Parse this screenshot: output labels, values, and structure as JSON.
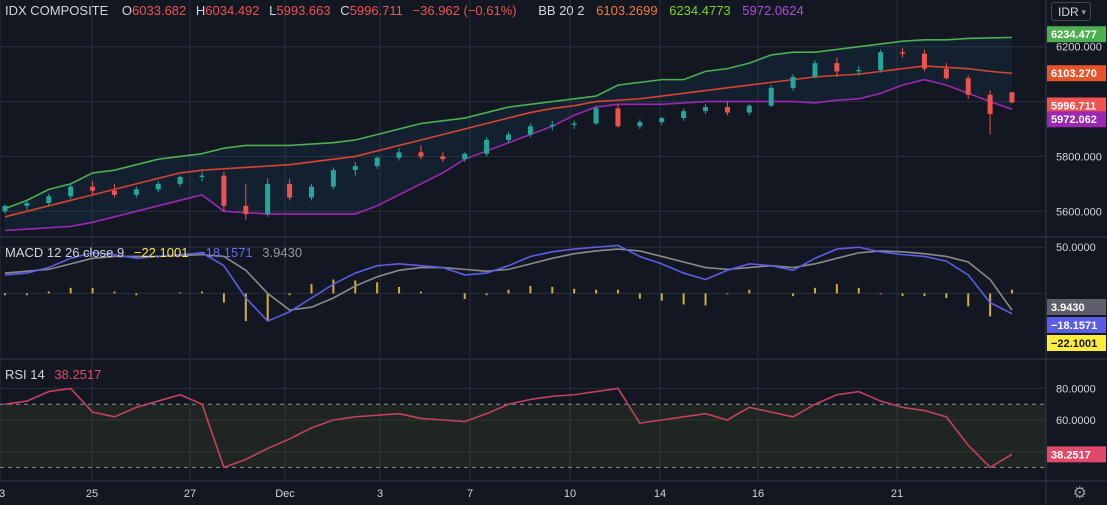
{
  "symbol": "IDX COMPOSITE",
  "ohlc": {
    "o_label": "O",
    "o": "6033.682",
    "h_label": "H",
    "h": "6034.492",
    "l_label": "L",
    "l": "5993.663",
    "c_label": "C",
    "c": "5996.711",
    "change": "−36.962 (−0.61%)"
  },
  "bb": {
    "label": "BB 20 2",
    "basis": "6103.2699",
    "upper": "6234.4773",
    "lower": "5972.0624"
  },
  "macd": {
    "label": "MACD 12 26 close 9",
    "macd": "−22.1001",
    "signal": "−18.1571",
    "hist": "3.9430"
  },
  "rsi": {
    "label": "RSI 14",
    "value": "38.2517"
  },
  "currency": "IDR",
  "colors": {
    "up": "#26a69a",
    "down": "#ef5350",
    "bb_upper": "#4caf50",
    "bb_basis": "#d5452f",
    "bb_lower": "#9c27b0",
    "macd": "#5b5ee5",
    "signal": "#8a8a8a",
    "hist": "#d4b03a",
    "rsi": "#c2425e"
  },
  "chart_data": [
    {
      "type": "candlestick",
      "title": "IDX COMPOSITE",
      "ylim": [
        5510,
        6290
      ],
      "y_ticks": [
        "6200.000",
        "5800.000",
        "5600.000"
      ],
      "x_ticks": [
        "3",
        "25",
        "27",
        "Dec",
        "3",
        "7",
        "10",
        "14",
        "16",
        "21"
      ],
      "price_labels": {
        "upper": "6234.477",
        "basis": "6103.270",
        "close": "5996.711",
        "lower": "5972.062"
      },
      "series": [
        {
          "name": "BB upper",
          "values": [
            5610,
            5640,
            5680,
            5700,
            5740,
            5750,
            5770,
            5790,
            5800,
            5810,
            5830,
            5840,
            5840,
            5840,
            5845,
            5850,
            5860,
            5880,
            5900,
            5920,
            5930,
            5940,
            5960,
            5980,
            5990,
            6000,
            6010,
            6020,
            6060,
            6070,
            6080,
            6080,
            6110,
            6120,
            6140,
            6170,
            6180,
            6180,
            6190,
            6200,
            6210,
            6220,
            6225,
            6225,
            6230,
            6232,
            6234
          ]
        },
        {
          "name": "BB basis",
          "values": [
            5580,
            5600,
            5620,
            5640,
            5660,
            5680,
            5700,
            5720,
            5740,
            5750,
            5755,
            5760,
            5765,
            5770,
            5780,
            5790,
            5800,
            5820,
            5840,
            5860,
            5880,
            5900,
            5920,
            5940,
            5960,
            5975,
            5985,
            6000,
            6005,
            6010,
            6020,
            6030,
            6040,
            6050,
            6060,
            6070,
            6080,
            6090,
            6095,
            6100,
            6110,
            6120,
            6130,
            6125,
            6120,
            6110,
            6103
          ]
        },
        {
          "name": "BB lower",
          "values": [
            5530,
            5535,
            5540,
            5545,
            5560,
            5580,
            5600,
            5620,
            5640,
            5660,
            5600,
            5595,
            5590,
            5590,
            5590,
            5590,
            5590,
            5620,
            5660,
            5700,
            5740,
            5790,
            5820,
            5850,
            5880,
            5910,
            5950,
            5980,
            5990,
            5990,
            5990,
            5995,
            6000,
            6000,
            6000,
            6000,
            6000,
            5995,
            6005,
            6010,
            6030,
            6060,
            6080,
            6060,
            6030,
            6000,
            5972
          ]
        }
      ],
      "candles": [
        {
          "o": 5600,
          "h": 5625,
          "l": 5590,
          "c": 5620
        },
        {
          "o": 5620,
          "h": 5640,
          "l": 5605,
          "c": 5630
        },
        {
          "o": 5630,
          "h": 5665,
          "l": 5620,
          "c": 5655
        },
        {
          "o": 5655,
          "h": 5700,
          "l": 5645,
          "c": 5690
        },
        {
          "o": 5690,
          "h": 5710,
          "l": 5660,
          "c": 5675
        },
        {
          "o": 5675,
          "h": 5700,
          "l": 5650,
          "c": 5660
        },
        {
          "o": 5660,
          "h": 5690,
          "l": 5650,
          "c": 5680
        },
        {
          "o": 5680,
          "h": 5710,
          "l": 5670,
          "c": 5700
        },
        {
          "o": 5700,
          "h": 5730,
          "l": 5690,
          "c": 5725
        },
        {
          "o": 5725,
          "h": 5745,
          "l": 5710,
          "c": 5730
        },
        {
          "o": 5730,
          "h": 5745,
          "l": 5600,
          "c": 5620
        },
        {
          "o": 5620,
          "h": 5700,
          "l": 5570,
          "c": 5590
        },
        {
          "o": 5590,
          "h": 5720,
          "l": 5580,
          "c": 5700
        },
        {
          "o": 5700,
          "h": 5720,
          "l": 5640,
          "c": 5650
        },
        {
          "o": 5650,
          "h": 5700,
          "l": 5640,
          "c": 5690
        },
        {
          "o": 5690,
          "h": 5760,
          "l": 5680,
          "c": 5750
        },
        {
          "o": 5750,
          "h": 5780,
          "l": 5730,
          "c": 5765
        },
        {
          "o": 5765,
          "h": 5800,
          "l": 5755,
          "c": 5795
        },
        {
          "o": 5795,
          "h": 5830,
          "l": 5785,
          "c": 5815
        },
        {
          "o": 5815,
          "h": 5840,
          "l": 5790,
          "c": 5800
        },
        {
          "o": 5800,
          "h": 5815,
          "l": 5780,
          "c": 5790
        },
        {
          "o": 5790,
          "h": 5815,
          "l": 5780,
          "c": 5810
        },
        {
          "o": 5810,
          "h": 5870,
          "l": 5800,
          "c": 5860
        },
        {
          "o": 5860,
          "h": 5890,
          "l": 5850,
          "c": 5880
        },
        {
          "o": 5880,
          "h": 5920,
          "l": 5870,
          "c": 5910
        },
        {
          "o": 5910,
          "h": 5930,
          "l": 5895,
          "c": 5915
        },
        {
          "o": 5915,
          "h": 5930,
          "l": 5900,
          "c": 5920
        },
        {
          "o": 5920,
          "h": 5985,
          "l": 5915,
          "c": 5975
        },
        {
          "o": 5975,
          "h": 5990,
          "l": 5905,
          "c": 5910
        },
        {
          "o": 5910,
          "h": 5935,
          "l": 5900,
          "c": 5925
        },
        {
          "o": 5925,
          "h": 5945,
          "l": 5915,
          "c": 5940
        },
        {
          "o": 5940,
          "h": 5975,
          "l": 5930,
          "c": 5965
        },
        {
          "o": 5965,
          "h": 5990,
          "l": 5955,
          "c": 5980
        },
        {
          "o": 5980,
          "h": 6000,
          "l": 5950,
          "c": 5960
        },
        {
          "o": 5960,
          "h": 5990,
          "l": 5950,
          "c": 5985
        },
        {
          "o": 5985,
          "h": 6060,
          "l": 5980,
          "c": 6050
        },
        {
          "o": 6050,
          "h": 6100,
          "l": 6040,
          "c": 6090
        },
        {
          "o": 6090,
          "h": 6150,
          "l": 6085,
          "c": 6140
        },
        {
          "o": 6140,
          "h": 6160,
          "l": 6090,
          "c": 6110
        },
        {
          "o": 6110,
          "h": 6130,
          "l": 6095,
          "c": 6115
        },
        {
          "o": 6115,
          "h": 6190,
          "l": 6105,
          "c": 6180
        },
        {
          "o": 6180,
          "h": 6195,
          "l": 6160,
          "c": 6175
        },
        {
          "o": 6175,
          "h": 6190,
          "l": 6110,
          "c": 6120
        },
        {
          "o": 6120,
          "h": 6140,
          "l": 6080,
          "c": 6085
        },
        {
          "o": 6085,
          "h": 6095,
          "l": 6010,
          "c": 6025
        },
        {
          "o": 6025,
          "h": 6040,
          "l": 5880,
          "c": 5955
        },
        {
          "o": 6033.682,
          "h": 6034.492,
          "l": 5993.663,
          "c": 5996.711
        }
      ]
    },
    {
      "type": "line",
      "title": "MACD 12 26 close 9",
      "ylim": [
        -70,
        60
      ],
      "y_ticks": [
        "50.0000"
      ],
      "price_labels": [
        "3.9430",
        "−18.1571",
        "−22.1001"
      ],
      "series": [
        {
          "name": "MACD",
          "values": [
            20,
            22,
            28,
            38,
            44,
            42,
            38,
            40,
            42,
            44,
            30,
            -5,
            -30,
            -20,
            -5,
            10,
            22,
            30,
            32,
            30,
            28,
            20,
            22,
            30,
            40,
            45,
            48,
            50,
            52,
            40,
            32,
            22,
            15,
            25,
            32,
            30,
            25,
            38,
            48,
            50,
            45,
            42,
            40,
            35,
            20,
            -10,
            -22.1001
          ]
        },
        {
          "name": "Signal",
          "values": [
            22,
            24,
            26,
            32,
            38,
            40,
            40,
            40,
            41,
            42,
            40,
            25,
            0,
            -18,
            -15,
            -5,
            8,
            18,
            25,
            28,
            28,
            26,
            24,
            26,
            32,
            38,
            43,
            46,
            48,
            46,
            40,
            34,
            28,
            26,
            28,
            30,
            28,
            32,
            38,
            44,
            46,
            45,
            43,
            40,
            34,
            15,
            -18.1571
          ]
        },
        {
          "name": "Histogram",
          "values": [
            -2,
            -2,
            2,
            6,
            6,
            2,
            -2,
            0,
            1,
            2,
            -10,
            -30,
            -30,
            -2,
            10,
            15,
            14,
            12,
            7,
            2,
            0,
            -6,
            -2,
            4,
            8,
            7,
            5,
            4,
            4,
            -6,
            -8,
            -12,
            -13,
            -1,
            4,
            0,
            -3,
            6,
            10,
            6,
            -1,
            -3,
            -3,
            -5,
            -14,
            -25,
            3.943
          ]
        }
      ]
    },
    {
      "type": "line",
      "title": "RSI 14",
      "ylim": [
        22,
        98
      ],
      "y_ticks": [
        "80.0000",
        "60.0000"
      ],
      "bands": [
        70,
        30
      ],
      "price_labels": [
        "38.2517"
      ],
      "series": [
        {
          "name": "RSI",
          "values": [
            70,
            72,
            78,
            80,
            65,
            62,
            68,
            72,
            76,
            70,
            30,
            35,
            42,
            48,
            55,
            60,
            62,
            63,
            64,
            61,
            60,
            59,
            64,
            70,
            73,
            75,
            76,
            78,
            80,
            58,
            60,
            62,
            64,
            60,
            68,
            65,
            62,
            70,
            76,
            78,
            72,
            68,
            66,
            62,
            44,
            30,
            38.2517
          ]
        }
      ]
    }
  ]
}
